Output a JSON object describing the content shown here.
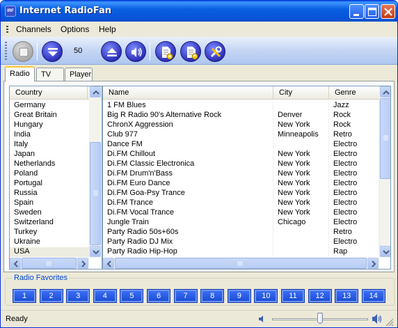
{
  "window": {
    "title": "Internet RadioFan",
    "app_icon_text": "IRF"
  },
  "menu": [
    "Channels",
    "Options",
    "Help"
  ],
  "toolbar": {
    "volume_value": "50"
  },
  "tabs": [
    "Radio",
    "TV",
    "Player"
  ],
  "countries": {
    "header": "Country",
    "items": [
      "Germany",
      "Great Britain",
      "Hungary",
      "India",
      "Italy",
      "Japan",
      "Netherlands",
      "Poland",
      "Portugal",
      "Russia",
      "Spain",
      "Sweden",
      "Switzerland",
      "Turkey",
      "Ukraine",
      "USA"
    ],
    "selected": "USA"
  },
  "stations": {
    "headers": [
      "Name",
      "City",
      "Genre"
    ],
    "rows": [
      [
        "1 FM Blues",
        "",
        "Jazz"
      ],
      [
        "Big R Radio 90's Alternative Rock",
        "Denver",
        "Rock"
      ],
      [
        "ChronX Aggression",
        "New York",
        "Rock"
      ],
      [
        "Club 977",
        "Minneapolis",
        "Retro"
      ],
      [
        "Dance FM",
        "",
        "Electro"
      ],
      [
        "Di.FM Chillout",
        "New York",
        "Electro"
      ],
      [
        "Di.FM Classic Electronica",
        "New York",
        "Electro"
      ],
      [
        "Di.FM Drum'n'Bass",
        "New York",
        "Electro"
      ],
      [
        "Di.FM Euro Dance",
        "New York",
        "Electro"
      ],
      [
        "Di.FM Goa-Psy Trance",
        "New York",
        "Electro"
      ],
      [
        "Di.FM Trance",
        "New York",
        "Electro"
      ],
      [
        "Di.FM Vocal Trance",
        "New York",
        "Electro"
      ],
      [
        "Jungle Train",
        "Chicago",
        "Electro"
      ],
      [
        "Party Radio 50s+60s",
        "",
        "Retro"
      ],
      [
        "Party Radio DJ Mix",
        "",
        "Electro"
      ],
      [
        "Party Radio Hip-Hop",
        "",
        "Rap"
      ]
    ]
  },
  "favorites": {
    "title": "Radio Favorites",
    "buttons": [
      "1",
      "2",
      "3",
      "4",
      "5",
      "6",
      "7",
      "8",
      "9",
      "10",
      "11",
      "12",
      "13",
      "14"
    ]
  },
  "status": {
    "text": "Ready",
    "volume_level": 0.5
  },
  "colors": {
    "title_blue": "#0A5FE0",
    "accent_blue": "#0046d5",
    "fav_button": "#2a5fe8"
  }
}
